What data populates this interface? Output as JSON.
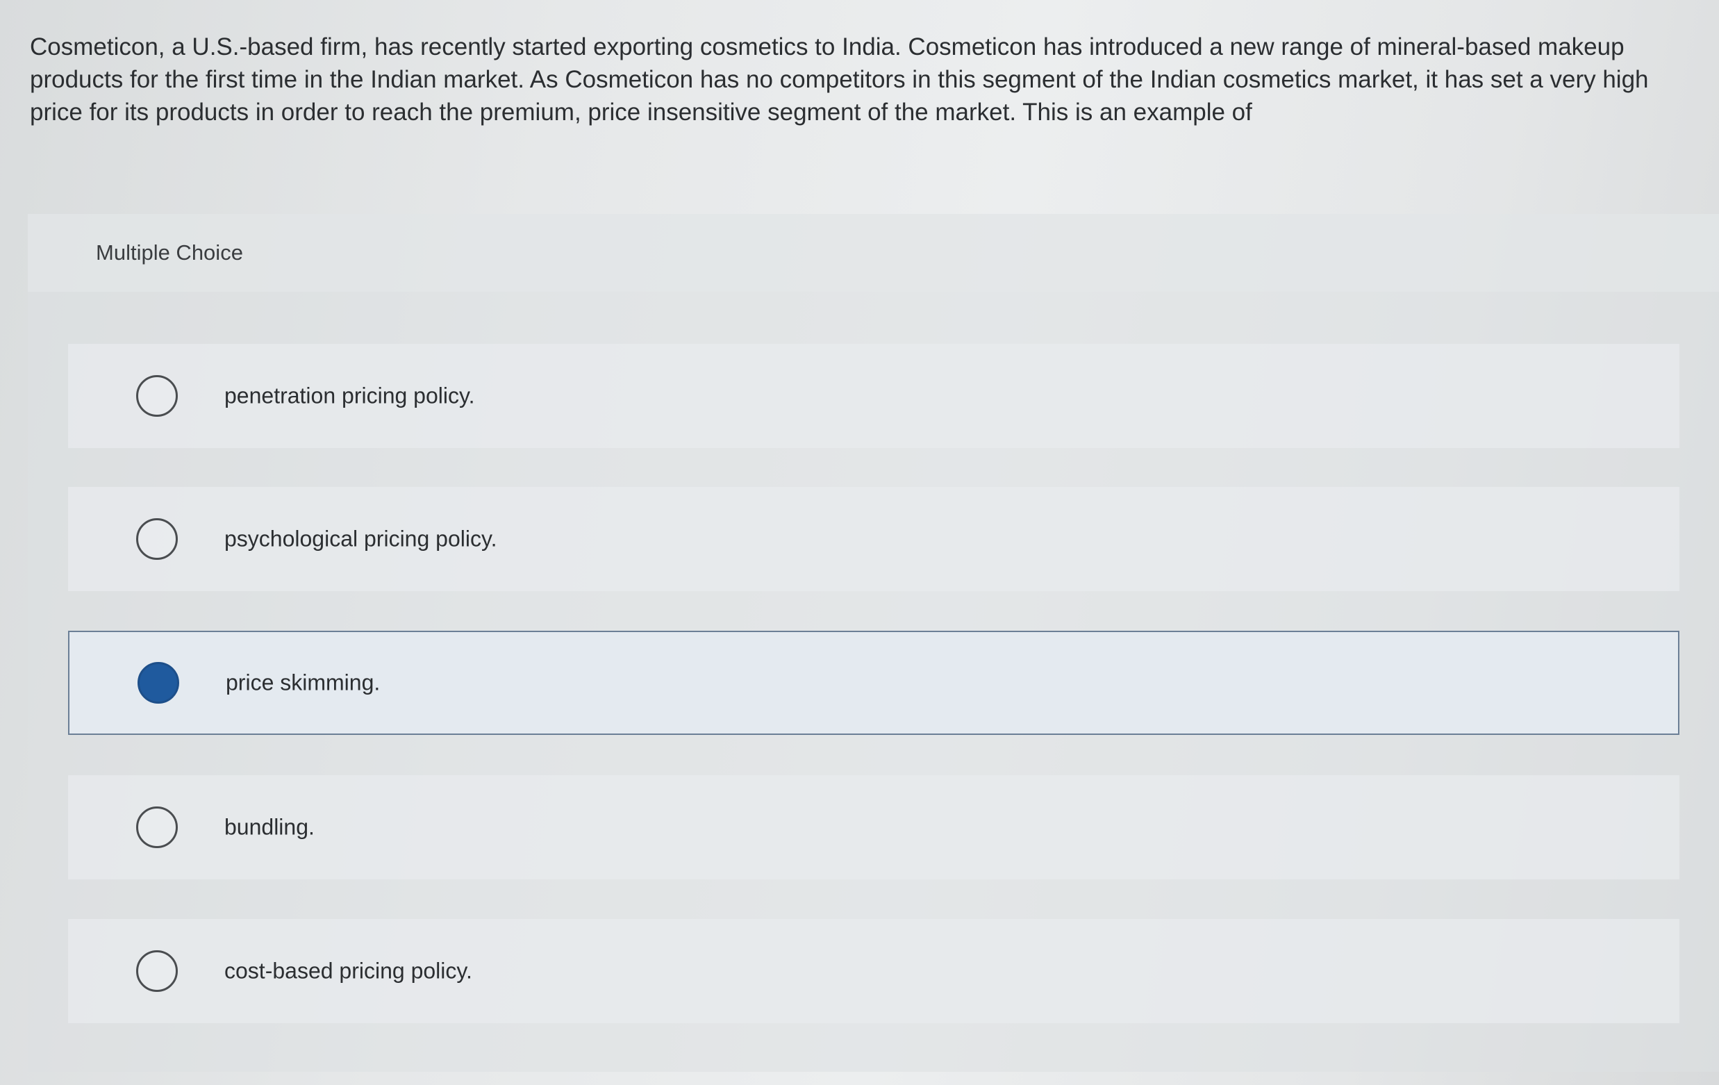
{
  "question": {
    "text": "Cosmeticon, a U.S.-based firm, has recently started exporting cosmetics to India. Cosmeticon has introduced a new range of mineral-based makeup products for the first time in the Indian market. As Cosmeticon has no competitors in this segment of the Indian cosmetics market, it has set a very high price for its products in order to reach the premium, price insensitive segment of the market. This is an example of"
  },
  "multiple_choice": {
    "label": "Multiple Choice",
    "selected_color": "#1f5a9e",
    "options": [
      {
        "text": "penetration pricing policy.",
        "selected": false
      },
      {
        "text": "psychological pricing policy.",
        "selected": false
      },
      {
        "text": "price skimming.",
        "selected": true
      },
      {
        "text": "bundling.",
        "selected": false
      },
      {
        "text": "cost-based pricing policy.",
        "selected": false
      }
    ]
  }
}
